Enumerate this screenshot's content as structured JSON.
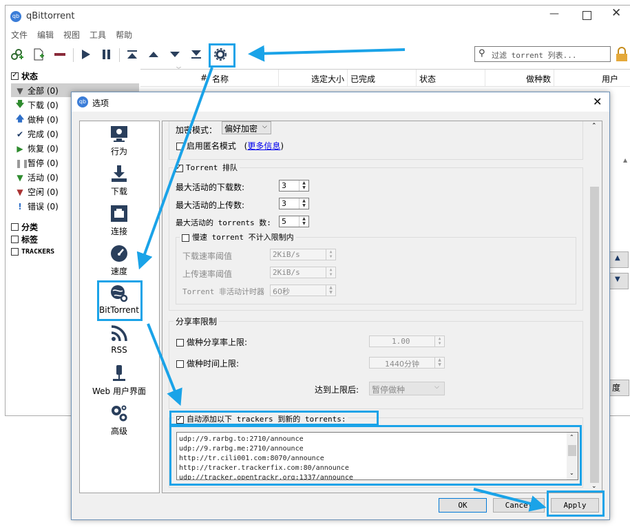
{
  "app": {
    "title": "qBittorrent"
  },
  "menu": [
    "文件",
    "编辑",
    "视图",
    "工具",
    "帮助"
  ],
  "search": {
    "placeholder": "过滤 torrent 列表..."
  },
  "table_headers": {
    "num": "#",
    "name": "名称",
    "selected_size": "选定大小",
    "done": "已完成",
    "status": "状态",
    "seeds": "做种数",
    "users": "用户"
  },
  "sidebar": {
    "status_title": "状态",
    "items": [
      {
        "label": "全部 (0)",
        "icon": "filter-icon"
      },
      {
        "label": "下载 (0)",
        "icon": "arrow-down-icon"
      },
      {
        "label": "做种 (0)",
        "icon": "arrow-up-icon"
      },
      {
        "label": "完成 (0)",
        "icon": "check-icon"
      },
      {
        "label": "恢复 (0)",
        "icon": "play-icon"
      },
      {
        "label": "暂停 (0)",
        "icon": "pause-icon"
      },
      {
        "label": "活动 (0)",
        "icon": "filter-icon"
      },
      {
        "label": "空闲 (0)",
        "icon": "filter-icon"
      },
      {
        "label": "错误 (0)",
        "icon": "error-icon"
      }
    ],
    "categories": "分类",
    "tags": "标签",
    "trackers": "TRACKERS"
  },
  "main_right_button": "度",
  "dialog": {
    "title": "选项",
    "nav": [
      "行为",
      "下载",
      "连接",
      "速度",
      "BitTorrent",
      "RSS",
      "Web 用户界面",
      "高级"
    ],
    "encryption": {
      "label": "加密模式：",
      "value": "偏好加密"
    },
    "anonymous": {
      "label": "启用匿名模式",
      "more_open": "(",
      "more_link": "更多信息",
      "more_close": ")"
    },
    "queue": {
      "title": "Torrent 排队",
      "max_dl_label": "最大活动的下载数:",
      "max_dl": "3",
      "max_ul_label": "最大活动的上传数:",
      "max_ul": "3",
      "max_tor_label": "最大活动的 torrents 数:",
      "max_tor": "5",
      "slow": {
        "title": "慢速 torrent 不计入限制内",
        "dl_label": "下载速率阈值",
        "dl_value": "2KiB/s",
        "ul_label": "上传速率阈值",
        "ul_value": "2KiB/s",
        "timer_label": "Torrent 非活动计时器",
        "timer_value": "60秒"
      }
    },
    "ratio": {
      "title": "分享率限制",
      "ratio_label": "做种分享率上限:",
      "ratio_value": "1.00",
      "time_label": "做种时间上限:",
      "time_value": "1440分钟",
      "after_label": "达到上限后:",
      "after_value": "暂停做种"
    },
    "trackers": {
      "label": "自动添加以下 trackers 到新的 torrents:",
      "lines": [
        "udp://9.rarbg.to:2710/announce",
        "udp://9.rarbg.me:2710/announce",
        "http://tr.cili001.com:8070/announce",
        "http://tracker.trackerfix.com:80/announce",
        "udp://tracker.opentrackr.org:1337/announce"
      ]
    },
    "buttons": {
      "ok": "OK",
      "cancel": "Cancel",
      "apply": "Apply"
    }
  },
  "colors": {
    "annotation": "#1aa3e8",
    "accent": "#0066cc"
  }
}
